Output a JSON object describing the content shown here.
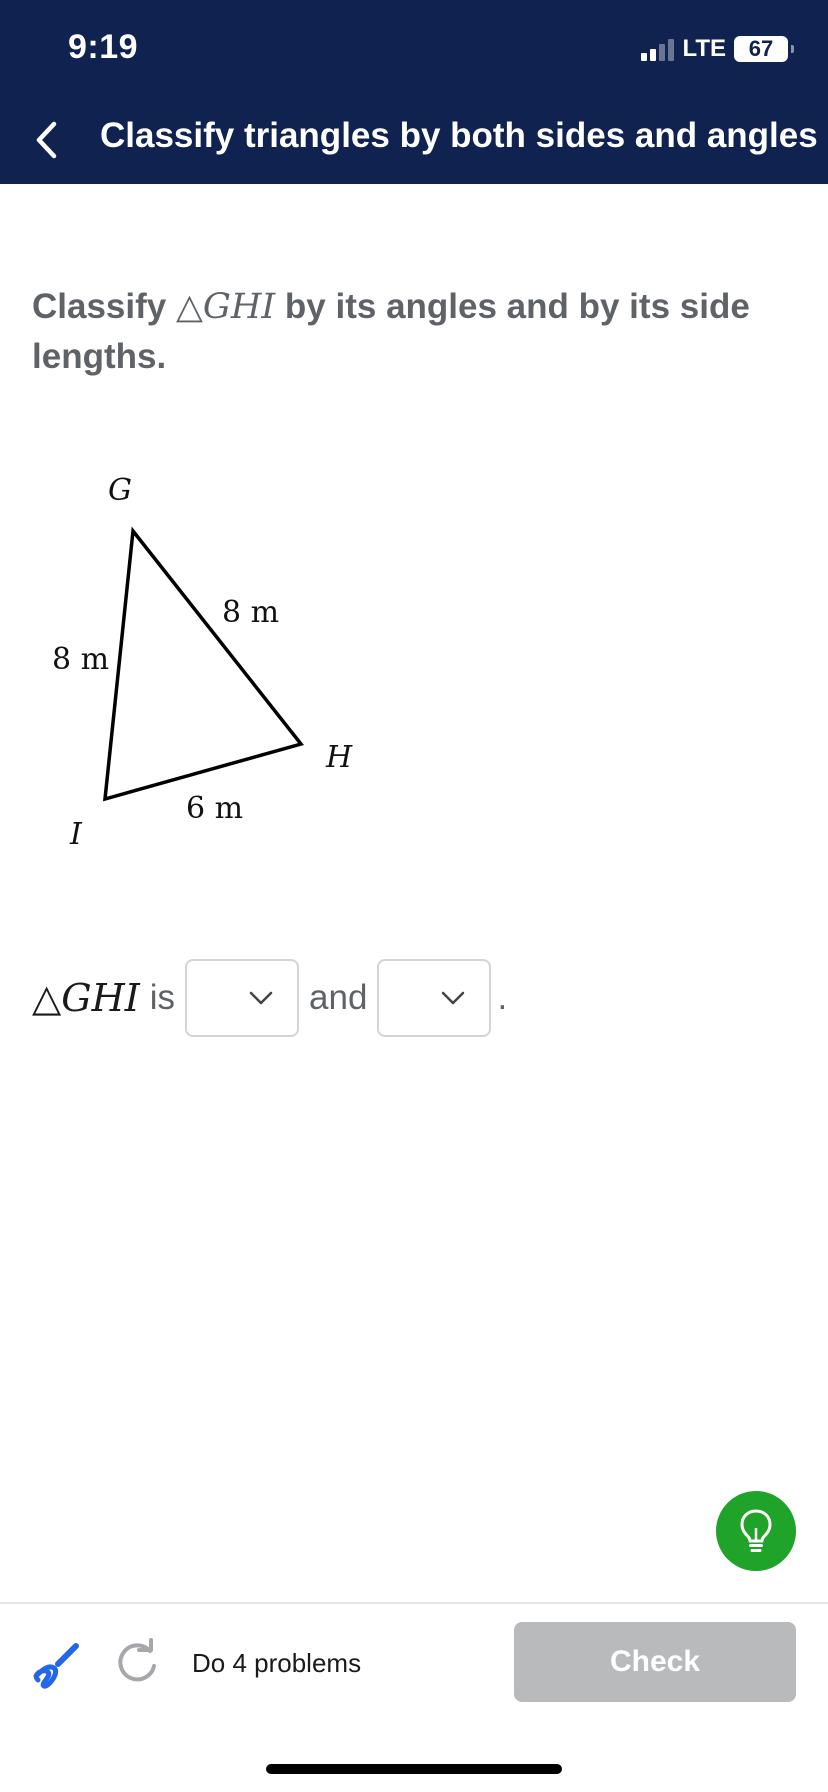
{
  "status_bar": {
    "time": "9:19",
    "network": "LTE",
    "battery": "67"
  },
  "nav": {
    "back_icon": "chevron-left-icon",
    "title": "Classify triangles by both sides and angles"
  },
  "question": {
    "prefix": "Classify ",
    "triangle_symbol": "△",
    "triangle_name": "GHI",
    "suffix": " by its angles and by its side lengths."
  },
  "figure": {
    "vertices": {
      "g": "G",
      "h": "H",
      "i": "I"
    },
    "sides": {
      "gh": "8 m",
      "gi": "8 m",
      "ih": "6 m"
    }
  },
  "answer": {
    "triangle_symbol": "△",
    "triangle_name": "GHI",
    "is_text": "is",
    "and_text": "and",
    "end_punct": ".",
    "dropdown_angles": {
      "selected": ""
    },
    "dropdown_sides": {
      "selected": ""
    }
  },
  "bottom_bar": {
    "scribble_icon": "scribble-icon",
    "redo_icon": "redo-icon",
    "progress_text": "Do 4 problems",
    "check_label": "Check"
  },
  "colors": {
    "header_bg": "#0f2250",
    "hint_green": "#1fa328",
    "check_disabled": "#b9babc"
  }
}
